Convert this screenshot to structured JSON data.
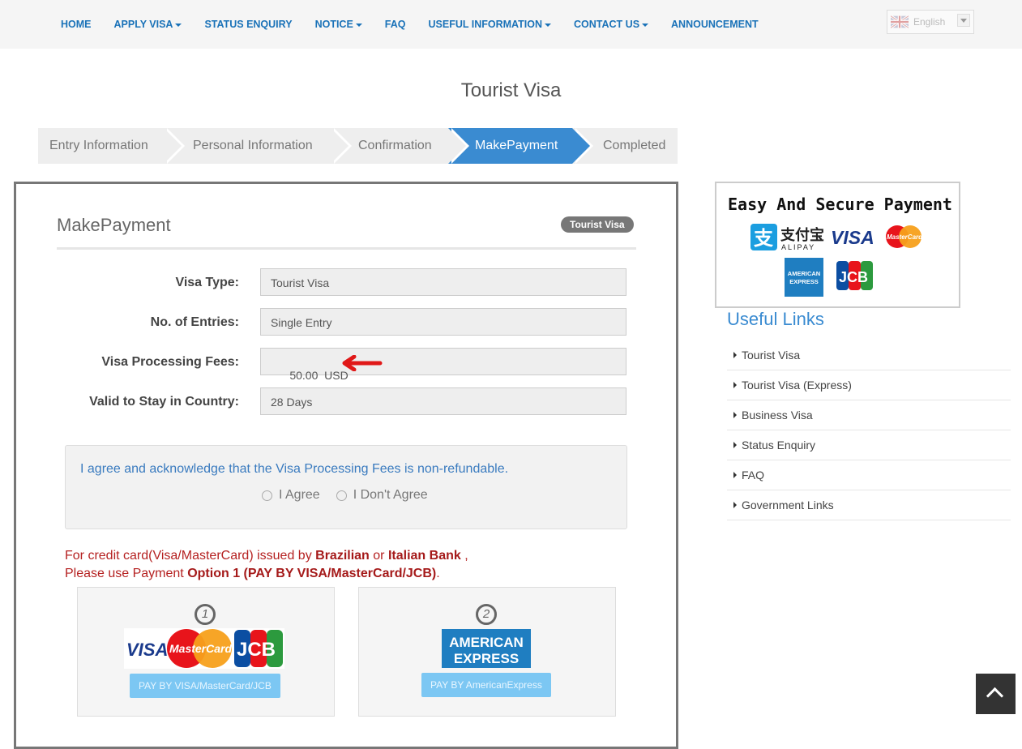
{
  "nav": {
    "items": [
      {
        "label": "HOME",
        "dropdown": false
      },
      {
        "label": "APPLY VISA",
        "dropdown": true
      },
      {
        "label": "STATUS ENQUIRY",
        "dropdown": false
      },
      {
        "label": "NOTICE",
        "dropdown": true
      },
      {
        "label": "FAQ",
        "dropdown": false
      },
      {
        "label": "USEFUL INFORMATION",
        "dropdown": true
      },
      {
        "label": "CONTACT US",
        "dropdown": true
      },
      {
        "label": "ANNOUNCEMENT",
        "dropdown": false
      }
    ],
    "language": "English"
  },
  "page_title": "Tourist Visa",
  "wizard": {
    "steps": [
      "Entry Information",
      "Personal Information",
      "Confirmation",
      "MakePayment",
      "Completed"
    ],
    "active": 3
  },
  "panel": {
    "title": "MakePayment",
    "badge": "Tourist Visa",
    "fields": [
      {
        "label": "Visa Type:",
        "value": "Tourist Visa"
      },
      {
        "label": "No. of Entries:",
        "value": "Single Entry"
      },
      {
        "label": "Visa Processing Fees:",
        "value": "50.00  USD"
      },
      {
        "label": "Valid to Stay in Country:",
        "value": "28 Days"
      }
    ],
    "agree": {
      "text": "I agree and acknowledge that the Visa Processing Fees is non-refundable.",
      "agree_label": "I Agree",
      "disagree_label": "I Don't Agree"
    },
    "notice": {
      "line1_a": "For credit card(Visa/MasterCard) issued by ",
      "line1_b": "Brazilian",
      "line1_c": " or ",
      "line1_d": "Italian Bank",
      "line1_e": " ,",
      "line2_a": "Please use Payment ",
      "line2_b": "Option 1 (PAY BY VISA/MasterCard/JCB)",
      "line2_c": "."
    },
    "options": [
      {
        "number": "1",
        "button": "PAY BY VISA/MasterCard/JCB"
      },
      {
        "number": "2",
        "button": "PAY BY AmericanExpress"
      }
    ]
  },
  "sidebar": {
    "secure_title": "Easy And Secure Payment",
    "alipay_cn": "支付宝",
    "alipay_en": "ALIPAY",
    "useful_title": "Useful Links",
    "links": [
      "Tourist Visa",
      "Tourist Visa (Express)",
      "Business Visa",
      "Status Enquiry",
      "FAQ",
      "Government Links"
    ]
  },
  "logos": {
    "visa": "VISA",
    "mastercard": "MasterCard",
    "jcb": "JCB",
    "amex_1": "AMERICAN",
    "amex_2": "EXPRESS"
  },
  "colors": {
    "accent": "#3a8bd1",
    "nav_text": "#1a72b8",
    "notice": "#b52121"
  }
}
